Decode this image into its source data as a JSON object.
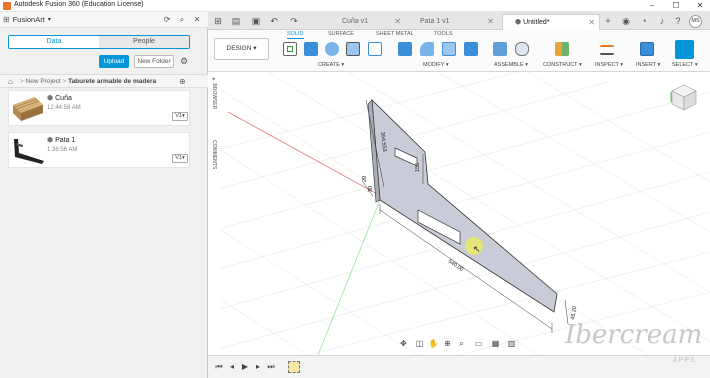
{
  "app": {
    "window_title": "Autodesk Fusion 360 (Education License)"
  },
  "colors": {
    "accent": "#0696d7",
    "model_fill": "#c9ccd6",
    "grid_line": "#e2e2e2",
    "axis_red": "#e04a4a",
    "axis_green": "#7bd67b"
  },
  "data_panel": {
    "project_name": "FusionArt",
    "tabs": [
      "Data",
      "People"
    ],
    "active_tab": "Data",
    "upload_label": "Upload",
    "new_folder_label": "New Folder",
    "breadcrumb": {
      "parent": "New Project",
      "current": "Taburete armable de madera"
    },
    "files": [
      {
        "name": "Cuña",
        "time": "12:44:58 AM",
        "version": "V1"
      },
      {
        "name": "Pata 1",
        "time": "1:36:56 AM",
        "version": "V1"
      }
    ]
  },
  "document_tabs": [
    {
      "label": "Cuña v1",
      "active": false
    },
    {
      "label": "Pata 1 v1",
      "active": false
    },
    {
      "label": "Untitled*",
      "active": true
    }
  ],
  "user_initials": "MS",
  "ribbon": {
    "workspace": "DESIGN",
    "tabs": [
      "SOLID",
      "SURFACE",
      "SHEET METAL",
      "TOOLS"
    ],
    "active_tab": "SOLID",
    "groups": [
      "CREATE",
      "MODIFY",
      "ASSEMBLE",
      "CONSTRUCT",
      "INSPECT",
      "INSERT",
      "SELECT"
    ]
  },
  "side_labels": {
    "browser": "BROWSER",
    "comments": "COMMENTS"
  },
  "dimensions": {
    "d1": "394.553",
    "d2": "155",
    "d3": "20",
    "d4": "30",
    "d5": "540.00",
    "d6": "45.20"
  },
  "watermark": {
    "text": "Ibercream",
    "sub": "APPS"
  }
}
